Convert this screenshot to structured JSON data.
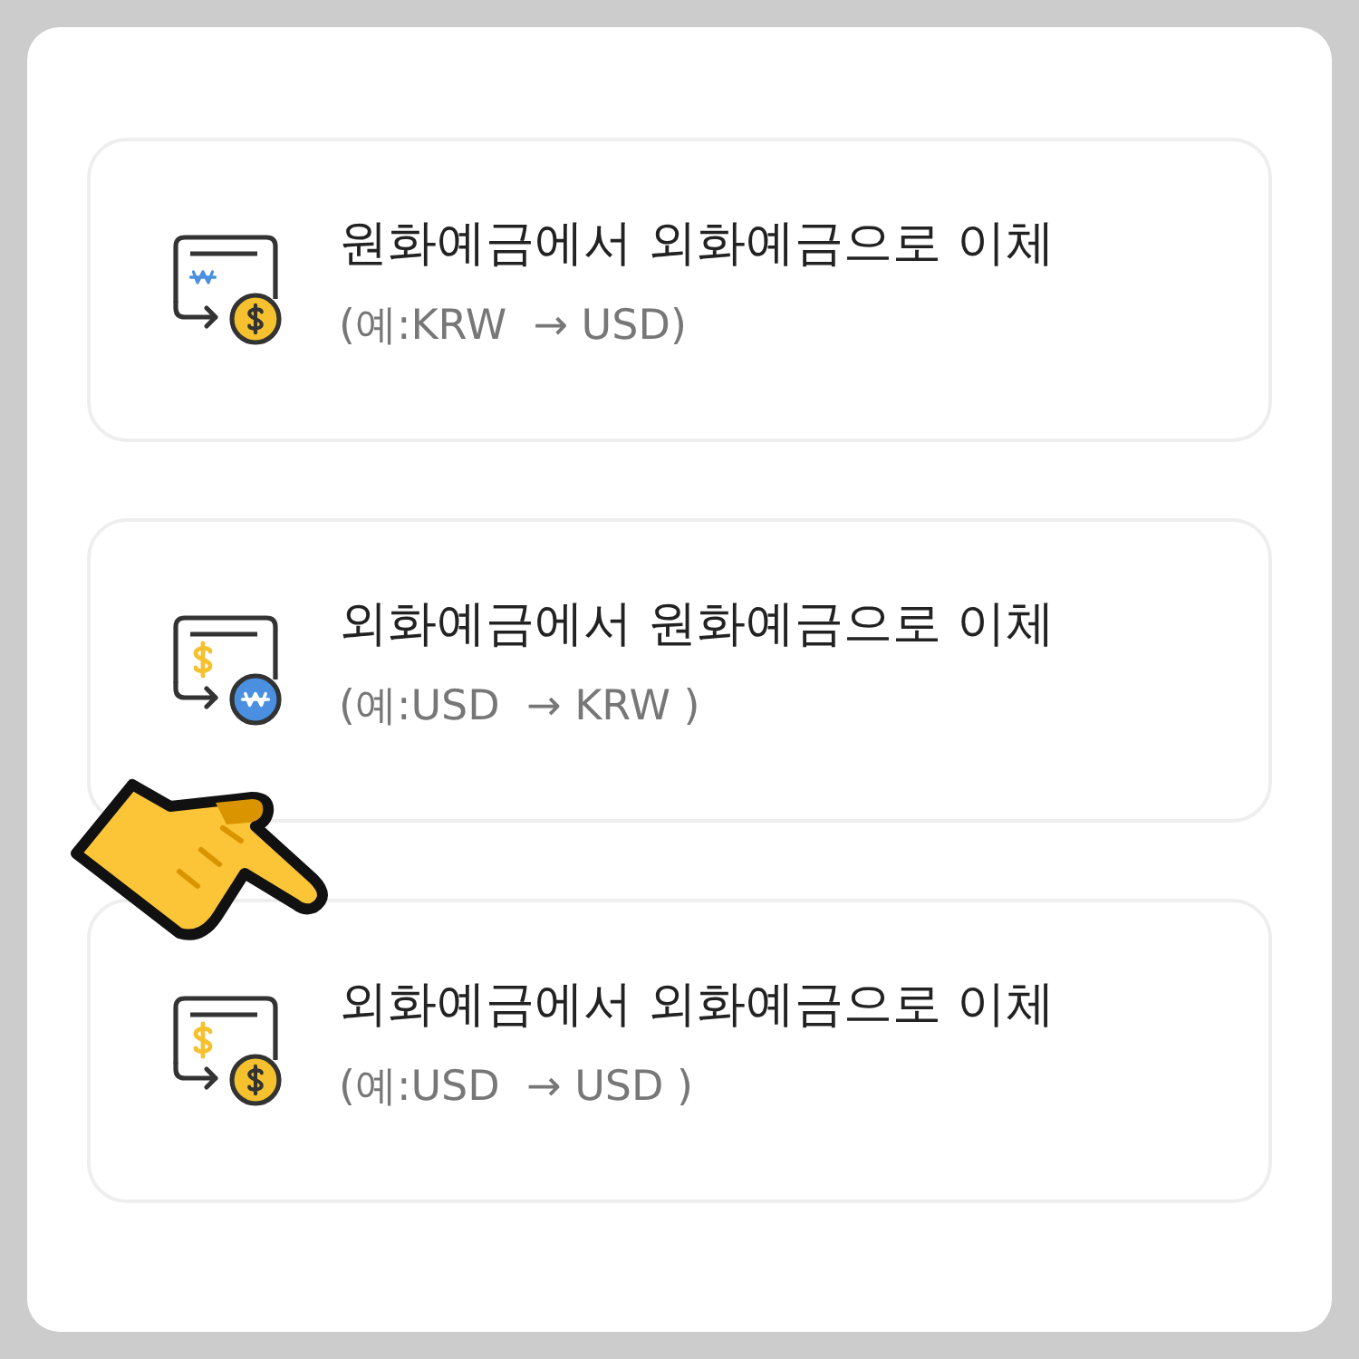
{
  "options": [
    {
      "kind": "krw_to_usd",
      "title": "원화예금에서 외화예금으로 이체",
      "example": "(예:KRW  → USD)",
      "selected": false
    },
    {
      "kind": "usd_to_krw",
      "title": "외화예금에서 원화예금으로 이체",
      "example": "(예:USD  → KRW )",
      "selected": false
    },
    {
      "kind": "usd_to_usd",
      "title": "외화예금에서 외화예금으로 이체",
      "example": "(예:USD  → USD )",
      "selected": true
    }
  ]
}
